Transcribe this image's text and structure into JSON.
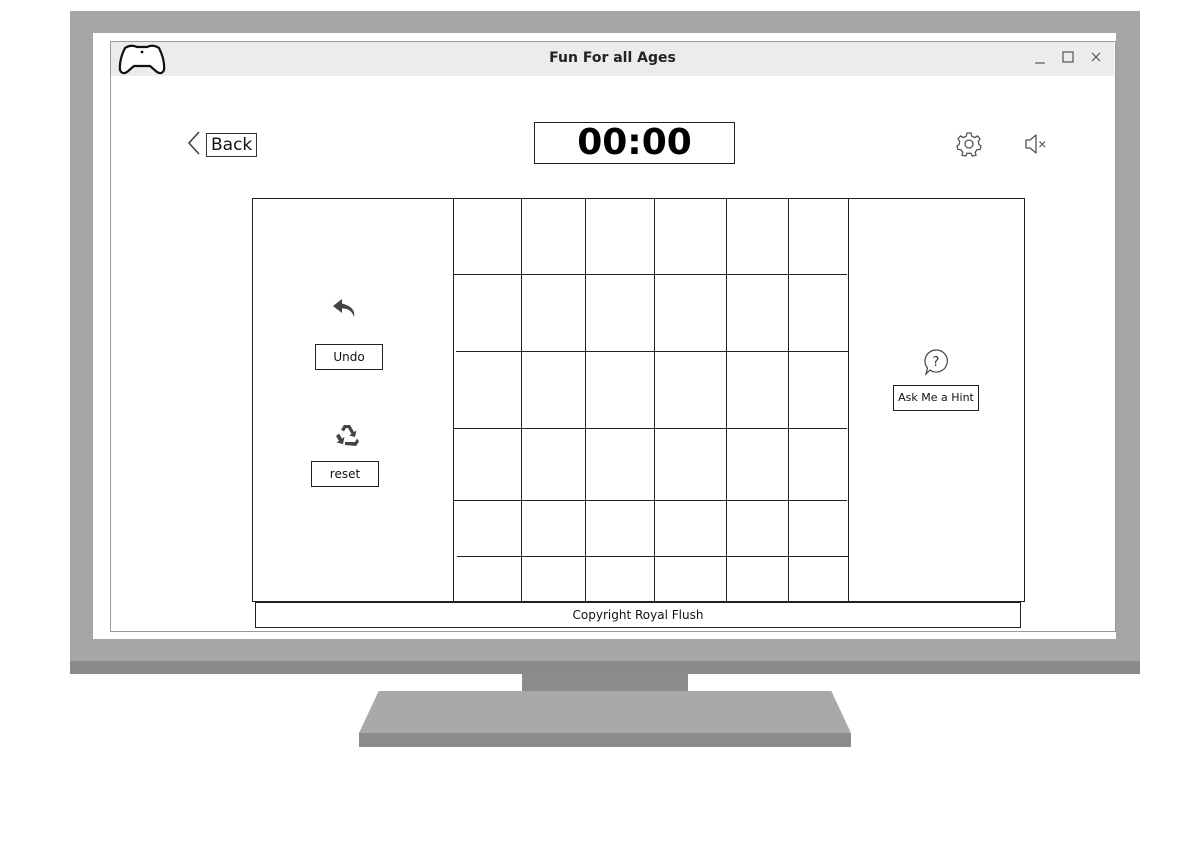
{
  "window": {
    "title": "Fun For all Ages",
    "app_icon": "gamepad-icon",
    "controls": [
      "minimize-icon",
      "maximize-icon",
      "close-icon"
    ]
  },
  "header": {
    "back_label": "Back",
    "timer": "00:00",
    "settings_icon": "gear-icon",
    "sound_icon": "speaker-muted-icon"
  },
  "left_panel": {
    "undo_icon": "undo-arrow-icon",
    "undo_label": "Undo",
    "reset_icon": "recycle-icon",
    "reset_label": "reset"
  },
  "right_panel": {
    "hint_icon": "question-bubble-icon",
    "hint_label": "Ask Me a Hint"
  },
  "grid": {
    "rows": 6,
    "columns": 6
  },
  "footer": {
    "text": "Copyright Royal Flush"
  }
}
